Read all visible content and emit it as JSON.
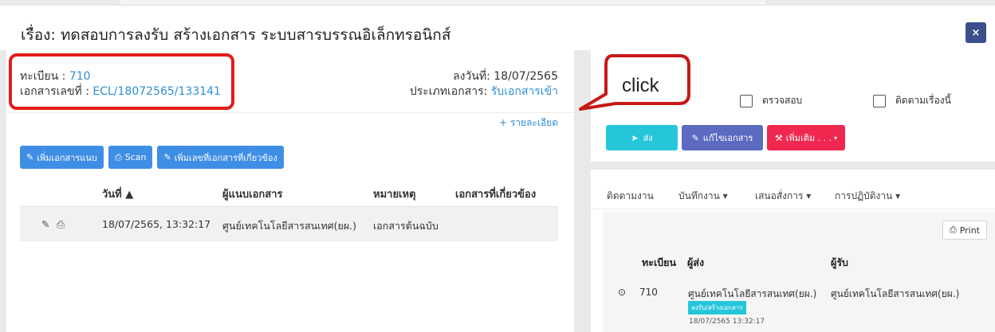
{
  "title": "เรื่อง: ทดสอบการลงรับ สร้างเอกสาร ระบบสารบรรณอิเล็กทรอนิกส์",
  "close_label": "×",
  "doc_info": {
    "reg_label": "ทะเบียน : ",
    "reg_no": "710",
    "doc_no_label": "เอกสารเลขที่ : ",
    "doc_no": "ECL/18072565/133141",
    "date_label": "ลงวันที่: 18/07/2565",
    "type_label": "ประเภทเอกสาร: ",
    "type_value": "รับเอกสารเข้า",
    "detail_link": "+ รายละเอียด"
  },
  "buttons": {
    "attach": "เพิ่มเอกสารแนบ",
    "scan": "Scan",
    "related": "เพิ่มเลขที่เอกสารที่เกี่ยวข้อง"
  },
  "table": {
    "headers": [
      "วันที่ ▲",
      "ผู้แนบเอกสาร",
      "หมายเหตุ",
      "เอกสารที่เกี่ยวข้อง"
    ],
    "rows": [
      {
        "date": "18/07/2565, 13:32:17",
        "attacher": "ศูนย์เทคโนโลยีสารสนเทศ(ยผ.)",
        "note": "เอกสารต้นฉบับ",
        "related": ""
      }
    ]
  },
  "checkboxes": {
    "check": "ตรวจสอบ",
    "follow": "ติดตามเรื่องนี้"
  },
  "actions": {
    "send": "ส่ง",
    "edit": "แก้ไขเอกสาร",
    "more": "เพิ่มเติม . . ."
  },
  "tabs": [
    "ติดตามงาน",
    "บันทึกงาน ▾",
    "เสนอสั่งการ ▾",
    "การปฏิบัติงาน ▾"
  ],
  "tracking": {
    "print": "Print",
    "headers": [
      "ทะเบียน",
      "ผู้ส่ง",
      "ผู้รับ"
    ],
    "row": {
      "reg": "710",
      "sender": "ศูนย์เทคโนโลยีสารสนเทศ(ยผ.)",
      "badge": "ลงรับ/สร้างเอกสาร",
      "datetime": "18/07/2565 13:32:17",
      "receiver": "ศูนย์เทคโนโลยีสารสนเทศ(ยผ.)"
    }
  },
  "annotation": {
    "callout_text": "click",
    "highlight_color": "#e41b1b"
  },
  "colors": {
    "primary_blue": "#3f8ee6",
    "send_teal": "#26c6da",
    "edit_indigo": "#5c6bc0",
    "more_pink": "#f0284f",
    "close_navy": "#3d4e8c"
  }
}
